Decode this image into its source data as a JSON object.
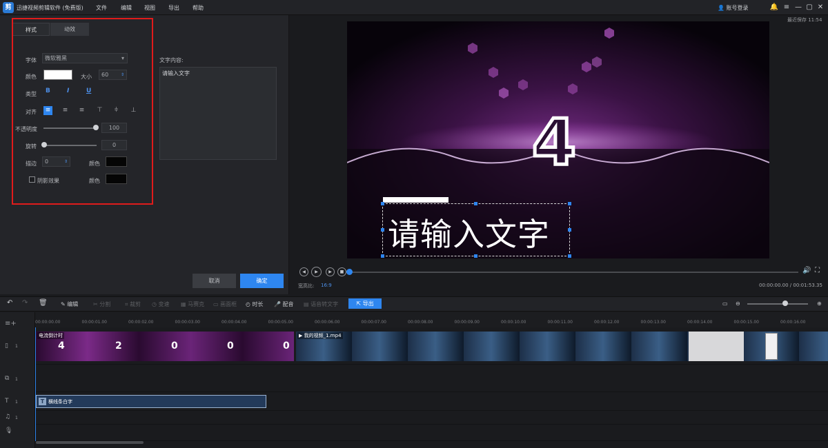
{
  "titlebar": {
    "app_title": "迅捷视频剪辑软件 (免费版)",
    "menu": [
      "文件",
      "编辑",
      "视图",
      "导出",
      "帮助"
    ],
    "login": "账号登录",
    "save_time": "最近保存 11:54"
  },
  "editor": {
    "tabs": [
      "样式",
      "动效"
    ],
    "font_label": "字体",
    "font_value": "微软雅黑",
    "color_label": "颜色",
    "size_label": "大小",
    "size_value": "60",
    "type_label": "类型",
    "type_bold": "B",
    "type_italic": "I",
    "type_underline": "U",
    "align_label": "对齐",
    "opacity_label": "不透明度",
    "opacity_value": "100",
    "rotate_label": "旋转",
    "rotate_value": "0",
    "stroke_label": "描边",
    "stroke_value": "0",
    "stroke_color_label": "颜色",
    "shadow_label": "阴影效果",
    "shadow_color_label": "颜色",
    "text_content_label": "文字内容:",
    "text_content_value": "请输入文字",
    "cancel_label": "取消",
    "ok_label": "确定",
    "colors": {
      "font_color": "#ffffff",
      "stroke_color": "#000000",
      "shadow_color": "#000000",
      "accent": "#2e86f0",
      "highlight_border": "#e11b1b"
    }
  },
  "preview": {
    "countdown_digit": "4",
    "caption_text": "请输入文字",
    "aspect_label": "宽高比:",
    "aspect_value": "16:9",
    "timecode": "00:00:00.00 / 00:01:53.35",
    "progress_fraction": 0.0
  },
  "toolbar": {
    "edit": "编辑",
    "split": "分割",
    "crop": "裁剪",
    "mosaic": "马赛克",
    "speed": "变速",
    "zoom_in": "画面框",
    "duration": "时长",
    "dub": "配音",
    "tts": "语音转文字",
    "export": "导出",
    "zoom_level": 0.6
  },
  "timeline": {
    "ticks": [
      "00:00:00.00",
      "00:00:01.00",
      "00:00:02.00",
      "00:00:03.00",
      "00:00:04.00",
      "00:00:05.00",
      "00:00:06.00",
      "00:00:07.00",
      "00:00:08.00",
      "00:00:09.00",
      "00:00:10.00",
      "00:00:11.00",
      "00:00:12.00",
      "00:00:13.00",
      "00:00:14.00",
      "00:00:15.00",
      "00:00:16.00"
    ],
    "clip1_label": "电流倒计时",
    "clip1_digits": [
      "4",
      "2",
      "0",
      "0",
      "0"
    ],
    "clip2_label": "我的视频_1.mp4",
    "text_clip_label": "横线条白字",
    "track_numbers": [
      "1",
      "1",
      "1",
      "1"
    ]
  }
}
